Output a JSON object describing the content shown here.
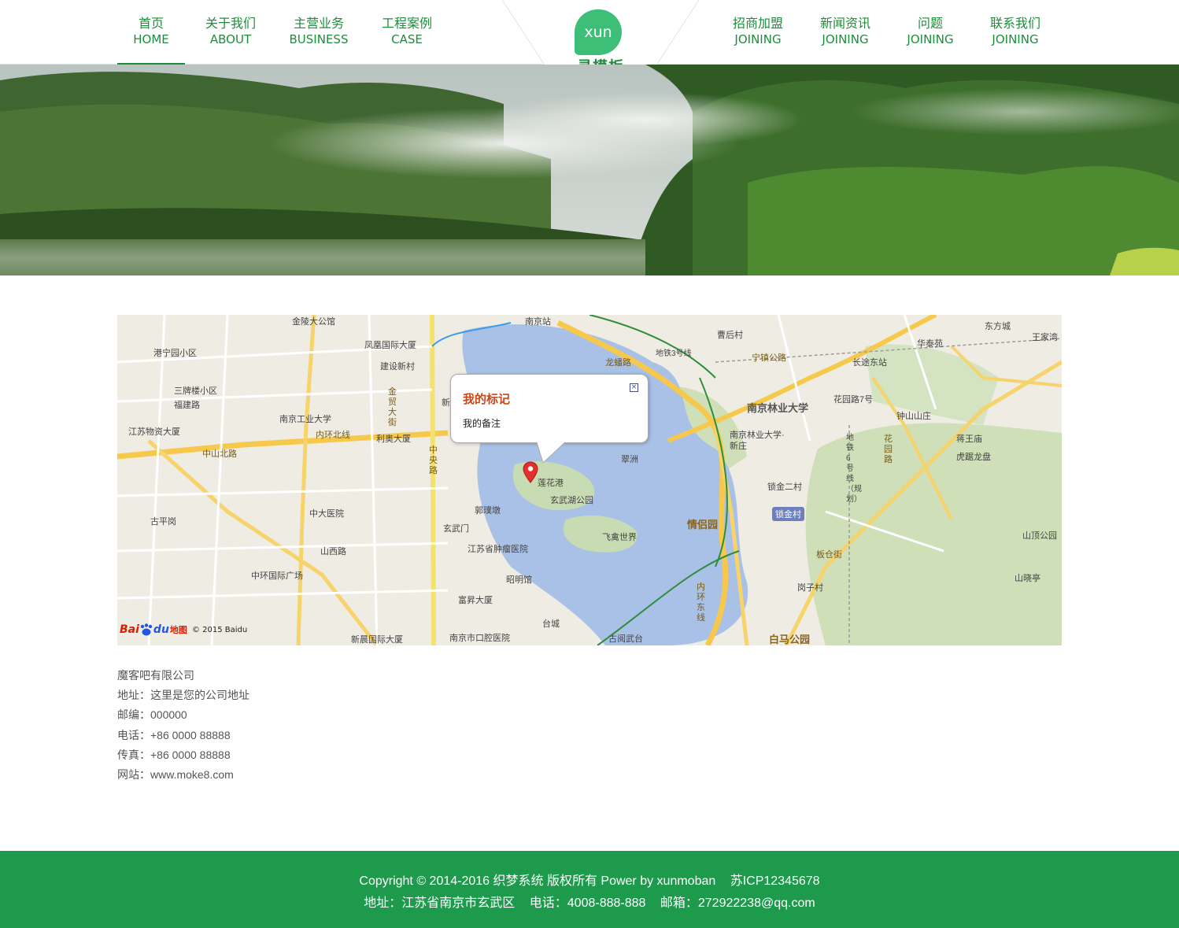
{
  "nav": {
    "left": [
      {
        "zh": "首页",
        "en": "HOME"
      },
      {
        "zh": "关于我们",
        "en": "ABOUT"
      },
      {
        "zh": "主营业务",
        "en": "BUSINESS"
      },
      {
        "zh": "工程案例",
        "en": "CASE"
      }
    ],
    "right": [
      {
        "zh": "招商加盟",
        "en": "JOINING"
      },
      {
        "zh": "新闻资讯",
        "en": "JOINING"
      },
      {
        "zh": "问题",
        "en": "JOINING"
      },
      {
        "zh": "联系我们",
        "en": "JOINING"
      }
    ],
    "active": "首页"
  },
  "logo": {
    "bubble": "xun",
    "text": "寻模板"
  },
  "map": {
    "popup_title": "我的标记",
    "popup_note": "我的备注",
    "close_glyph": "×",
    "logo_bai": "Bai",
    "logo_du": "du",
    "logo_map": "地图",
    "copyright": "© 2015 Baidu",
    "labels": [
      "金陵大公馆",
      "港宁园小区",
      "凤凰国际大厦",
      "建设新村",
      "三牌楼小区",
      "福建路",
      "南京工业大学",
      "江苏物资大厦",
      "利奥大厦",
      "内环北线",
      "中山北路",
      "古平岗",
      "中大医院",
      "玄武门",
      "江苏省肿瘤医院",
      "山西路",
      "中环国际广场",
      "昭明馆",
      "富昇大厦",
      "新晨国际大厦",
      "南京市口腔医院",
      "台城",
      "古阅武台",
      "南京站",
      "曹后村",
      "龙蟠路",
      "宁镇公路",
      "地铁3号线",
      "南京林业大学",
      "南京林业大学·新庄",
      "花园路7号",
      "锁金二村",
      "锁金村",
      "情侣园",
      "翠洲",
      "莲花港",
      "玄武湖公园",
      "郭璞墩",
      "飞禽世界",
      "岗子村",
      "白马公园",
      "长途东站",
      "东方城",
      "王家湾",
      "华泰苑",
      "钟山山庄",
      "蒋王庙",
      "虎踞龙盘",
      "山顶公园",
      "山晓亭",
      "中央路",
      "金贸大街",
      "内环东线",
      "花园路",
      "板仓街",
      "地铁6号线（规划）",
      "新"
    ]
  },
  "contact": {
    "company": "魔客吧有限公司",
    "address": "地址：这里是您的公司地址",
    "postcode": "邮编：000000",
    "phone": "电话：+86 0000 88888",
    "fax": "传真：+86 0000 88888",
    "website": "网站：www.moke8.com"
  },
  "footer": {
    "copyright": "Copyright © 2014-2016 织梦系统 版权所有 Power by xunmoban",
    "icp": "苏ICP12345678",
    "address": "地址：江苏省南京市玄武区",
    "phone": "电话：4008-888-888",
    "email": "邮箱：272922238@qq.com"
  },
  "colors": {
    "brand_green": "#1d8d3b",
    "footer_green": "#1e9a4c",
    "logo_green": "#3dbf77"
  }
}
